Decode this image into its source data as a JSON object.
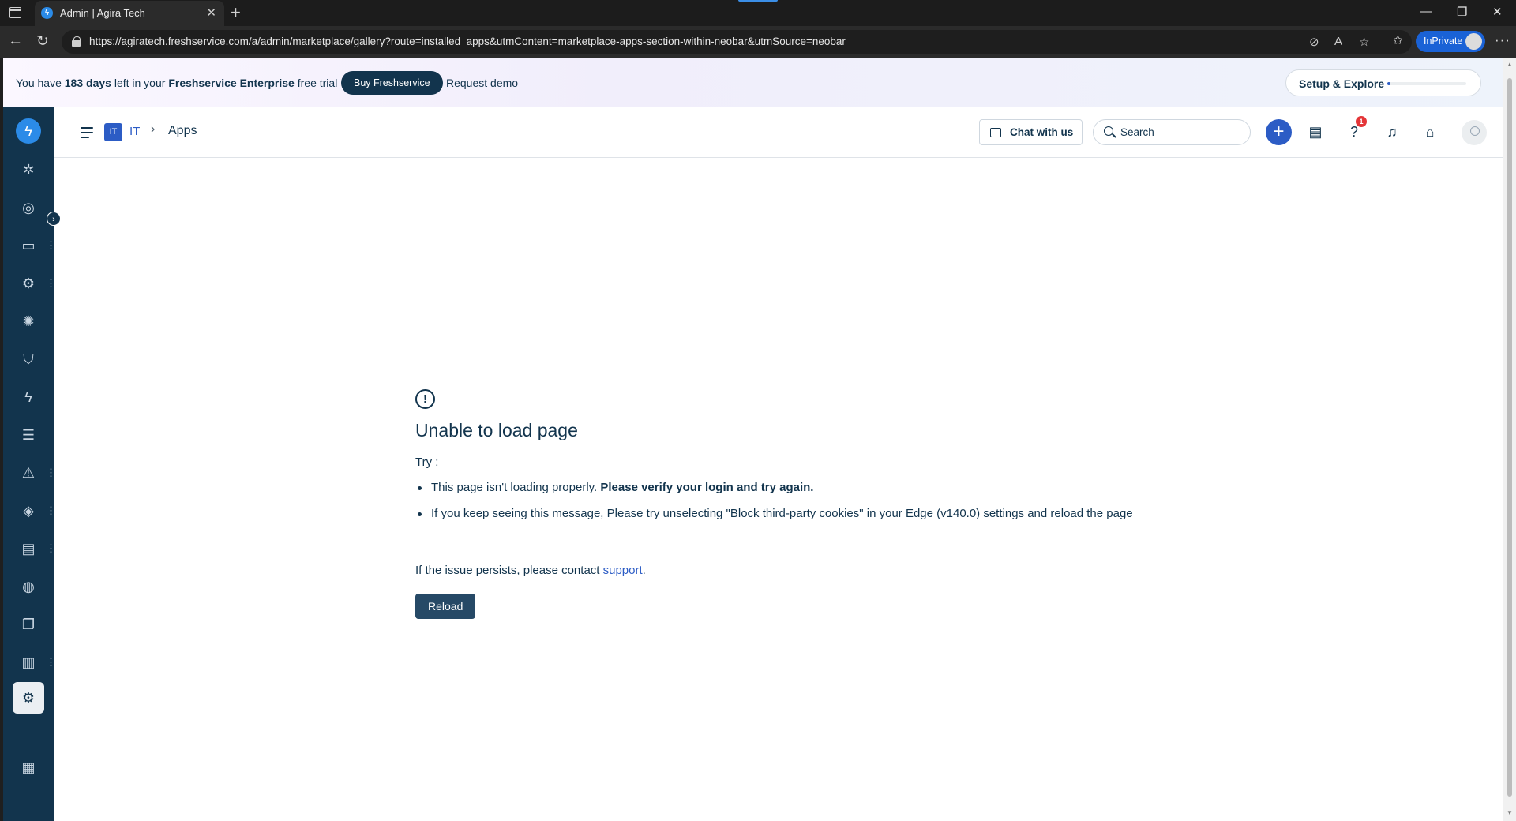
{
  "browser": {
    "tab_title": "Admin | Agira Tech",
    "url": "https://agiratech.freshservice.com/a/admin/marketplace/gallery?route=installed_apps&utmContent=marketplace-apps-section-within-neobar&utmSource=neobar",
    "inprivate_label": "InPrivate"
  },
  "trial_bar": {
    "prefix": "You have ",
    "days": "183 days",
    "middle": " left in your ",
    "plan": "Freshservice Enterprise",
    "suffix": " free trial",
    "buy_label": "Buy Freshservice",
    "demo_label": "Request demo",
    "setup_label": "Setup & Explore",
    "setup_progress": 0.04
  },
  "header": {
    "workspace_badge": "IT",
    "workspace_name": "IT",
    "page_title": "Apps",
    "chat_label": "Chat with us",
    "search_placeholder": "Search",
    "help_badge_count": "1"
  },
  "sidebar": {
    "items": [
      {
        "name": "dashboard-icon",
        "glyph": "✲"
      },
      {
        "name": "gauge-icon",
        "glyph": "◎"
      },
      {
        "name": "tickets-icon",
        "glyph": "▭",
        "menu": true
      },
      {
        "name": "problems-icon",
        "glyph": "⚙",
        "menu": true
      },
      {
        "name": "changes-icon",
        "glyph": "✺"
      },
      {
        "name": "releases-icon",
        "glyph": "⛉"
      },
      {
        "name": "automation-icon",
        "glyph": "ϟ"
      },
      {
        "name": "tasks-icon",
        "glyph": "☰"
      },
      {
        "name": "alerts-icon",
        "glyph": "⚠",
        "menu": true
      },
      {
        "name": "assets-icon",
        "glyph": "◈",
        "menu": true
      },
      {
        "name": "contracts-icon",
        "glyph": "▤",
        "menu": true
      },
      {
        "name": "support-icon",
        "glyph": "◍"
      },
      {
        "name": "solutions-icon",
        "glyph": "❐"
      },
      {
        "name": "reports-icon",
        "glyph": "▥",
        "menu": true
      },
      {
        "name": "admin-icon",
        "glyph": "⚙",
        "active": true
      },
      {
        "name": "catalog-icon",
        "glyph": "▦"
      }
    ]
  },
  "error": {
    "title": "Unable to load page",
    "try_label": "Try :",
    "tip1_text": "This page isn't loading properly. ",
    "tip1_bold": "Please verify your login and try again.",
    "tip2_text": "If you keep seeing this message, Please try unselecting \"Block third-party cookies\" in your Edge (v140.0) settings and reload the page",
    "persist_text": "If the issue persists, please contact ",
    "support_link": "support",
    "persist_end": ".",
    "reload_label": "Reload"
  }
}
